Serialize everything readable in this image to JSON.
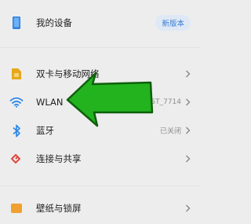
{
  "device": {
    "label": "我的设备",
    "badge": "新版本",
    "icon": "phone-icon"
  },
  "items": [
    {
      "key": "sim",
      "label": "双卡与移动网络",
      "value": "",
      "icon": "sim-card-icon",
      "color": "#e6a81a"
    },
    {
      "key": "wlan",
      "label": "WLAN",
      "value": "FAST_7714",
      "icon": "wifi-icon",
      "color": "#2f88e6"
    },
    {
      "key": "bluetooth",
      "label": "蓝牙",
      "value": "已关闭",
      "icon": "bluetooth-icon",
      "color": "#2f88e6"
    },
    {
      "key": "share",
      "label": "连接与共享",
      "value": "",
      "icon": "share-icon",
      "color": "#e0483e"
    },
    {
      "key": "wallpaper",
      "label": "壁纸与锁屏",
      "value": "",
      "icon": "wallpaper-icon",
      "color": "#f0a030"
    }
  ],
  "colors": {
    "background": "#ededed",
    "accent": "#3a7bd5",
    "arrow_fill": "#22b31f",
    "arrow_stroke": "#0f5f0c"
  }
}
